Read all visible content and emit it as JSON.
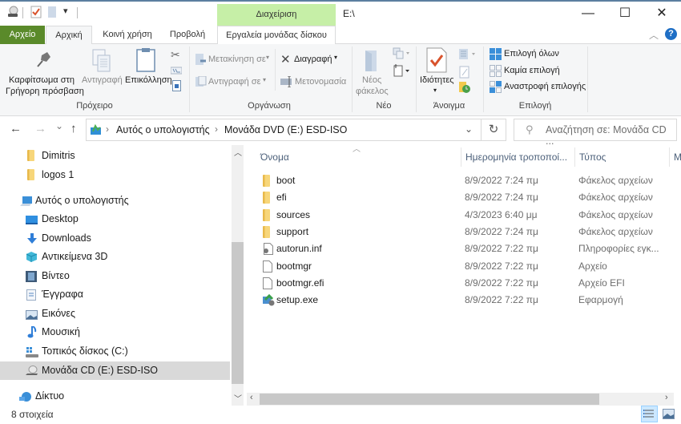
{
  "window": {
    "title_path": "E:\\",
    "context_tab_header": "Διαχείριση",
    "buttons": {
      "minimize": "—",
      "maximize": "☐",
      "close": "✕"
    },
    "help": "?"
  },
  "quick_access": {
    "dropdown": "▾"
  },
  "tabs": [
    {
      "label": "Αρχείο"
    },
    {
      "label": "Αρχική"
    },
    {
      "label": "Κοινή χρήση"
    },
    {
      "label": "Προβολή"
    },
    {
      "label": "Εργαλεία μονάδας δίσκου"
    }
  ],
  "ribbon": {
    "clipboard": {
      "pin_line1": "Καρφίτσωμα στη",
      "pin_line2": "Γρήγορη πρόσβαση",
      "copy": "Αντιγραφή",
      "paste": "Επικόλληση",
      "group": "Πρόχειρο"
    },
    "organize": {
      "move_to": "Μετακίνηση σε",
      "copy_to": "Αντιγραφή σε",
      "delete": "Διαγραφή",
      "rename": "Μετονομασία",
      "group": "Οργάνωση"
    },
    "new": {
      "new_folder_line1": "Νέος",
      "new_folder_line2": "φάκελος",
      "group": "Νέο"
    },
    "open": {
      "properties": "Ιδιότητες",
      "group": "Άνοιγμα"
    },
    "select": {
      "select_all": "Επιλογή όλων",
      "select_none": "Καμία επιλογή",
      "invert": "Αναστροφή επιλογής",
      "group": "Επιλογή"
    }
  },
  "nav": {
    "back": "←",
    "forward": "→",
    "recent": "⌄",
    "up": "↑",
    "breadcrumb": [
      "Αυτός ο υπολογιστής",
      "Μονάδα DVD (E:) ESD-ISO"
    ],
    "separator": "›",
    "refresh": "↻",
    "search_placeholder": "Αναζήτηση σε: Μονάδα CD ..."
  },
  "sidebar": {
    "items": [
      {
        "label": "Dimitris",
        "icon": "folder-icon"
      },
      {
        "label": "logos 1",
        "icon": "folder-icon"
      },
      {
        "label": "Αυτός ο υπολογιστής",
        "icon": "computer-icon"
      },
      {
        "label": "Desktop",
        "icon": "desktop-icon"
      },
      {
        "label": "Downloads",
        "icon": "downloads-icon"
      },
      {
        "label": "Αντικείμενα 3D",
        "icon": "3d-objects-icon"
      },
      {
        "label": "Βίντεο",
        "icon": "video-icon"
      },
      {
        "label": "Έγγραφα",
        "icon": "documents-icon"
      },
      {
        "label": "Εικόνες",
        "icon": "pictures-icon"
      },
      {
        "label": "Μουσική",
        "icon": "music-icon"
      },
      {
        "label": "Τοπικός δίσκος (C:)",
        "icon": "local-disk-icon"
      },
      {
        "label": "Μονάδα CD (E:) ESD-ISO",
        "icon": "cd-drive-icon",
        "selected": true
      },
      {
        "label": "Δίκτυο",
        "icon": "network-icon"
      }
    ]
  },
  "file_list": {
    "columns": [
      "Όνομα",
      "Ημερομηνία τροποποί...",
      "Τύπος",
      "Μ"
    ],
    "rows": [
      {
        "name": "boot",
        "date": "8/9/2022 7:24 πμ",
        "type": "Φάκελος αρχείων",
        "icon": "folder"
      },
      {
        "name": "efi",
        "date": "8/9/2022 7:24 πμ",
        "type": "Φάκελος αρχείων",
        "icon": "folder"
      },
      {
        "name": "sources",
        "date": "4/3/2023 6:40 μμ",
        "type": "Φάκελος αρχείων",
        "icon": "folder"
      },
      {
        "name": "support",
        "date": "8/9/2022 7:24 πμ",
        "type": "Φάκελος αρχείων",
        "icon": "folder"
      },
      {
        "name": "autorun.inf",
        "date": "8/9/2022 7:22 πμ",
        "type": "Πληροφορίες εγκ...",
        "icon": "setup-info"
      },
      {
        "name": "bootmgr",
        "date": "8/9/2022 7:22 πμ",
        "type": "Αρχείο",
        "icon": "file"
      },
      {
        "name": "bootmgr.efi",
        "date": "8/9/2022 7:22 πμ",
        "type": "Αρχείο EFI",
        "icon": "file"
      },
      {
        "name": "setup.exe",
        "date": "8/9/2022 7:22 πμ",
        "type": "Εφαρμογή",
        "icon": "exe"
      }
    ]
  },
  "status": {
    "item_count": "8 στοιχεία"
  },
  "colors": {
    "file_tab": "#5a8a2a",
    "context_header": "#c6efa7",
    "selected_nav": "#d9d9d9"
  }
}
